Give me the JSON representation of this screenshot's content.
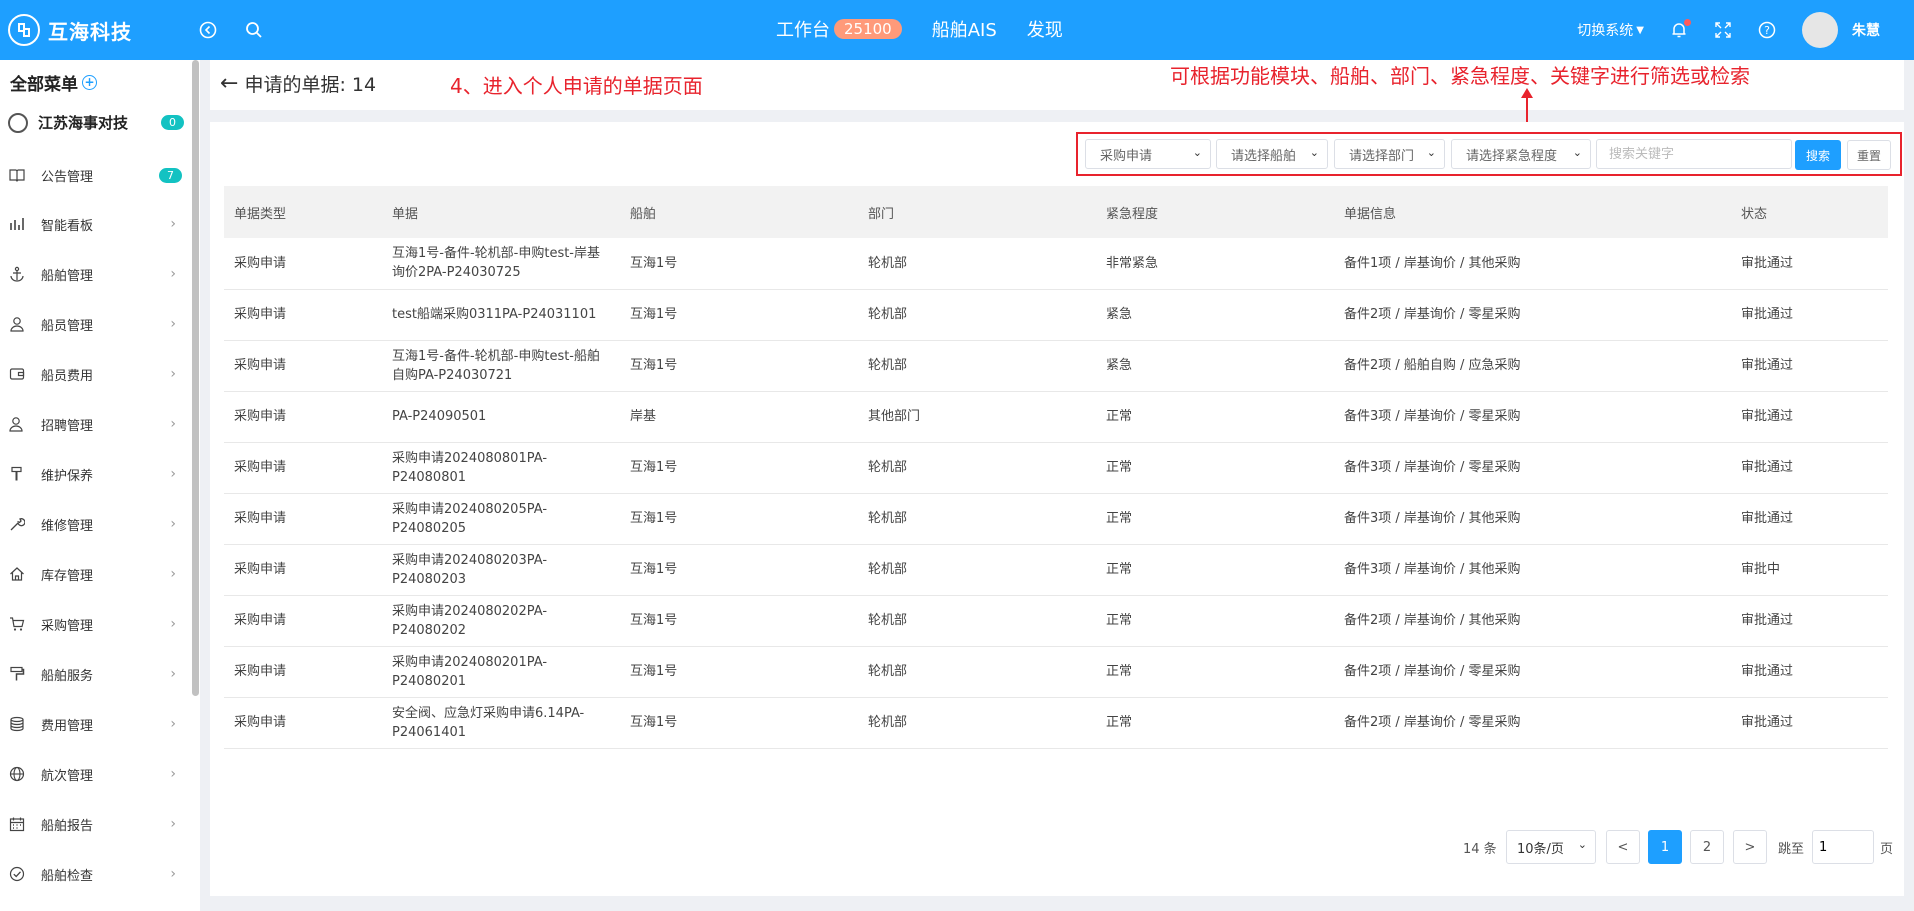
{
  "topbar": {
    "logo_mark": "尾",
    "brand": "互海科技",
    "nav": [
      {
        "label": "工作台",
        "badge": "25100"
      },
      {
        "label": "船舶AIS"
      },
      {
        "label": "发现"
      }
    ],
    "switch_system": "切换系统",
    "user_name": "朱慧",
    "brand_color": "#1e9fff"
  },
  "sidebar": {
    "title": "全部菜单",
    "org": {
      "name": "江苏海事对技",
      "count": "0"
    },
    "items": [
      {
        "label": "公告管理",
        "icon": "book-icon",
        "count": "7"
      },
      {
        "label": "智能看板",
        "icon": "bar-chart-icon"
      },
      {
        "label": "船舶管理",
        "icon": "anchor-icon"
      },
      {
        "label": "船员管理",
        "icon": "user-icon"
      },
      {
        "label": "船员费用",
        "icon": "wallet-icon"
      },
      {
        "label": "招聘管理",
        "icon": "user-plus-icon"
      },
      {
        "label": "维护保养",
        "icon": "brush-icon"
      },
      {
        "label": "维修管理",
        "icon": "wrench-icon"
      },
      {
        "label": "库存管理",
        "icon": "home-icon"
      },
      {
        "label": "采购管理",
        "icon": "cart-icon"
      },
      {
        "label": "船舶服务",
        "icon": "roller-icon"
      },
      {
        "label": "费用管理",
        "icon": "database-icon"
      },
      {
        "label": "航次管理",
        "icon": "globe-icon"
      },
      {
        "label": "船舶报告",
        "icon": "calendar-icon"
      },
      {
        "label": "船舶检查",
        "icon": "check-circle-icon"
      }
    ]
  },
  "header": {
    "title": "申请的单据: 14",
    "annotation_step": "4、进入个人申请的单据页面",
    "annotation_filter": "可根据功能模块、船舶、部门、紧急程度、关键字进行筛选或检索"
  },
  "filters": {
    "module": "采购申请",
    "ship": "请选择船舶",
    "department": "请选择部门",
    "urgency": "请选择紧急程度",
    "keyword_placeholder": "搜索关键字",
    "search_label": "搜索",
    "reset_label": "重置"
  },
  "table": {
    "columns": [
      "单据类型",
      "单据",
      "船舶",
      "部门",
      "紧急程度",
      "单据信息",
      "状态"
    ],
    "rows": [
      [
        "采购申请",
        "互海1号-备件-轮机部-申购test-岸基询价2PA-P24030725",
        "互海1号",
        "轮机部",
        "非常紧急",
        "备件1项 / 岸基询价 / 其他采购",
        "审批通过"
      ],
      [
        "采购申请",
        "test船端采购0311PA-P24031101",
        "互海1号",
        "轮机部",
        "紧急",
        "备件2项 / 岸基询价 / 零星采购",
        "审批通过"
      ],
      [
        "采购申请",
        "互海1号-备件-轮机部-申购test-船舶自购PA-P24030721",
        "互海1号",
        "轮机部",
        "紧急",
        "备件2项 / 船舶自购 / 应急采购",
        "审批通过"
      ],
      [
        "采购申请",
        "PA-P24090501",
        "岸基",
        "其他部门",
        "正常",
        "备件3项 / 岸基询价 / 零星采购",
        "审批通过"
      ],
      [
        "采购申请",
        "采购申请2024080801PA-P24080801",
        "互海1号",
        "轮机部",
        "正常",
        "备件3项 / 岸基询价 / 零星采购",
        "审批通过"
      ],
      [
        "采购申请",
        "采购申请2024080205PA-P24080205",
        "互海1号",
        "轮机部",
        "正常",
        "备件3项 / 岸基询价 / 其他采购",
        "审批通过"
      ],
      [
        "采购申请",
        "采购申请2024080203PA-P24080203",
        "互海1号",
        "轮机部",
        "正常",
        "备件3项 / 岸基询价 / 其他采购",
        "审批中"
      ],
      [
        "采购申请",
        "采购申请2024080202PA-P24080202",
        "互海1号",
        "轮机部",
        "正常",
        "备件2项 / 岸基询价 / 其他采购",
        "审批通过"
      ],
      [
        "采购申请",
        "采购申请2024080201PA-P24080201",
        "互海1号",
        "轮机部",
        "正常",
        "备件2项 / 岸基询价 / 零星采购",
        "审批通过"
      ],
      [
        "采购申请",
        "安全阀、应急灯采购申请6.14PA-P24061401",
        "互海1号",
        "轮机部",
        "正常",
        "备件2项 / 岸基询价 / 零星采购",
        "审批通过"
      ]
    ]
  },
  "pagination": {
    "total": "14 条",
    "page_size": "10条/页",
    "prev": "<",
    "pages": [
      "1",
      "2"
    ],
    "next": ">",
    "jump_label": "跳至",
    "jump_value": "1",
    "page_unit": "页"
  }
}
